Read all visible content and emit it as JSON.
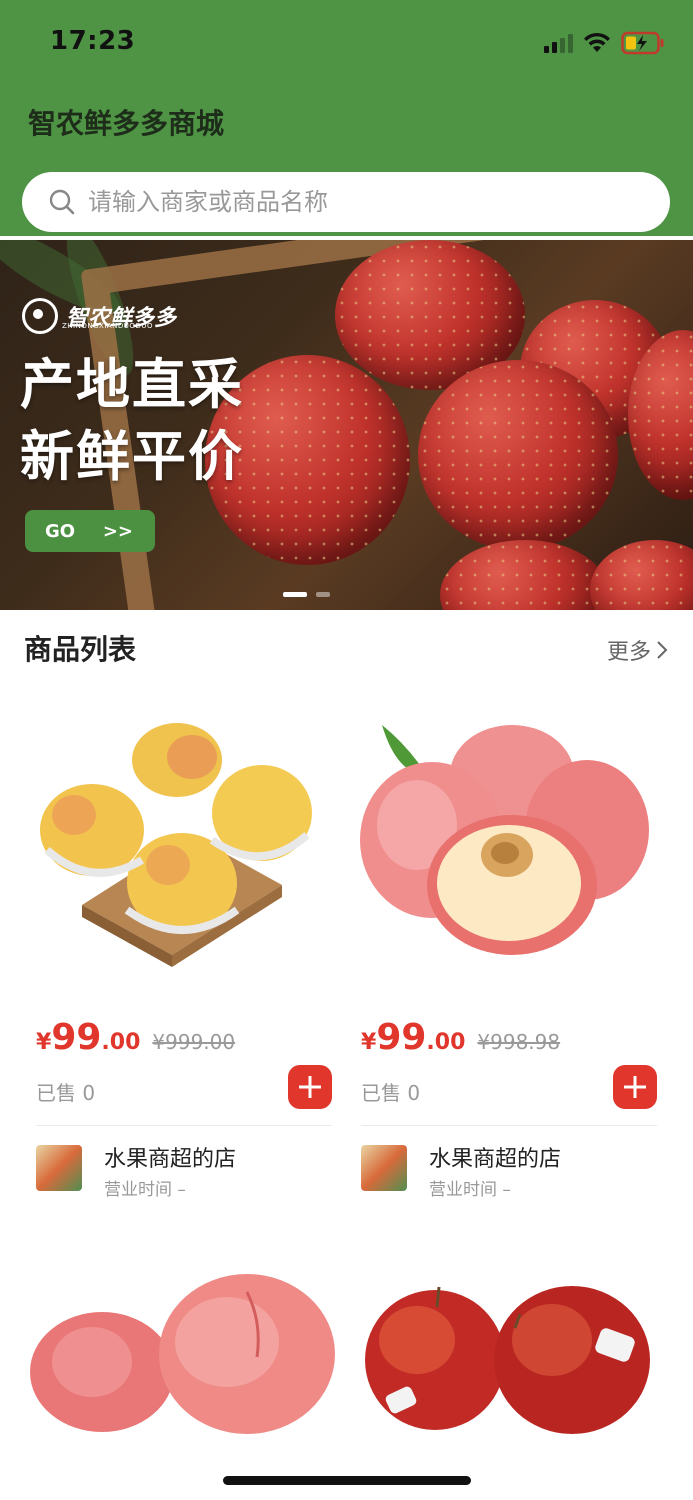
{
  "status_bar": {
    "time": "17:23"
  },
  "header": {
    "title": "智农鲜多多商城",
    "search_placeholder": "请输入商家或商品名称"
  },
  "banner": {
    "logo_text": "智农鲜多多",
    "logo_subtitle": "ZHINONGXIANDUODUO",
    "slogan_line1": "产地直采",
    "slogan_line2": "新鲜平价",
    "go_label": "GO",
    "go_arrows": ">>"
  },
  "section": {
    "title": "商品列表",
    "more_label": "更多"
  },
  "products": [
    {
      "currency": "¥",
      "price_int": "99",
      "price_dec": ".00",
      "original_price": "¥999.00",
      "sold_label": "已售 0",
      "shop_name": "水果商超的店",
      "shop_hours": "营业时间 –"
    },
    {
      "currency": "¥",
      "price_int": "99",
      "price_dec": ".00",
      "original_price": "¥998.98",
      "sold_label": "已售 0",
      "shop_name": "水果商超的店",
      "shop_hours": "营业时间 –"
    }
  ],
  "colors": {
    "header_green": "#4e9444",
    "price_red": "#e0362c",
    "button_red": "#e0362c"
  },
  "icons": {
    "search": "search-icon",
    "add": "plus-icon",
    "more": "chevron-right-icon"
  }
}
